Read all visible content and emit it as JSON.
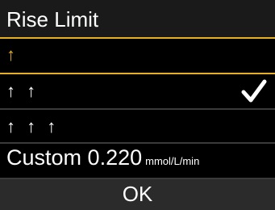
{
  "title": "Rise Limit",
  "accent_color": "#e8b01e",
  "options": [
    {
      "label": "↑",
      "selected": true,
      "checked": false
    },
    {
      "label": "↑ ↑",
      "selected": false,
      "checked": true
    },
    {
      "label": "↑ ↑ ↑",
      "selected": false,
      "checked": false
    }
  ],
  "custom": {
    "label": "Custom",
    "value": "0.220",
    "unit": "mmol/L/min"
  },
  "check_icon": "checkmark-icon",
  "ok_label": "OK"
}
